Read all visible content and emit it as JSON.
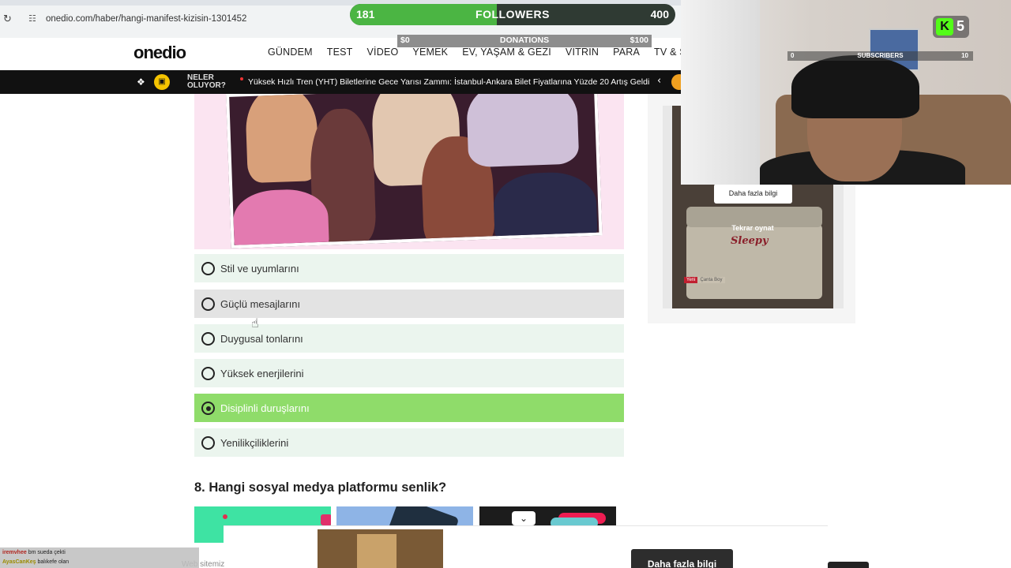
{
  "browser": {
    "url": "onedio.com/haber/hangi-manifest-kizisin-1301452",
    "reload_icon": "reload-icon",
    "site_info_icon": "site-info-icon"
  },
  "site": {
    "logo": "onedio",
    "nav": [
      "GÜNDEM",
      "TEST",
      "VİDEO",
      "YEMEK",
      "EV, YAŞAM & GEZİ",
      "VİTRİN",
      "PARA",
      "TV & SİNEMA"
    ]
  },
  "ticker": {
    "label": "NELER OLUYOR?",
    "headline": "Yüksek Hızlı Tren (YHT) Biletlerine Gece Yarısı Zammı: İstanbul-Ankara Bilet Fiyatlarına Yüzde 20 Artış Geldi"
  },
  "quiz": {
    "options": [
      {
        "label": "Stil ve uyumlarını",
        "state": "default"
      },
      {
        "label": "Güçlü mesajlarını",
        "state": "hover"
      },
      {
        "label": "Duygusal tonlarını",
        "state": "default"
      },
      {
        "label": "Yüksek enerjilerini",
        "state": "default"
      },
      {
        "label": "Disiplinli duruşlarını",
        "state": "selected"
      },
      {
        "label": "Yenilikçiliklerini",
        "state": "default"
      }
    ],
    "next_question": "8. Hangi sosyal medya platformu senlik?"
  },
  "sidebar_ad": {
    "info_button": "Daha fazla bilgi",
    "replay": "Tekrar oynat",
    "brand": "Sleepy",
    "tag_new": "Yeni",
    "tag_bag": "Çanta Boy"
  },
  "bottom_ad": {
    "cta": "Daha fazla bilgi"
  },
  "footer": {
    "text": "Web sitemiz"
  },
  "overlay": {
    "followers": {
      "current": "181",
      "title": "FOLLOWERS",
      "goal": "400",
      "progress": 0.4525
    },
    "donations": {
      "current": "$0",
      "title": "DONATIONS",
      "goal": "$100"
    },
    "subscribers": {
      "current": "0",
      "title": "SUBSCRIBERS",
      "goal": "10"
    },
    "kick": {
      "count": "5"
    }
  },
  "chat": [
    {
      "user": "iremvhee",
      "message": "bm sueda çekti"
    },
    {
      "user": "AyasCanKeş",
      "message": "balıkefe olan"
    }
  ],
  "colors": {
    "option_bg": "#ebf5ee",
    "option_hover": "#e3e3e3",
    "option_selected": "#8fdc6a",
    "followers_green": "#4bb543",
    "kick_green": "#53fc18"
  }
}
